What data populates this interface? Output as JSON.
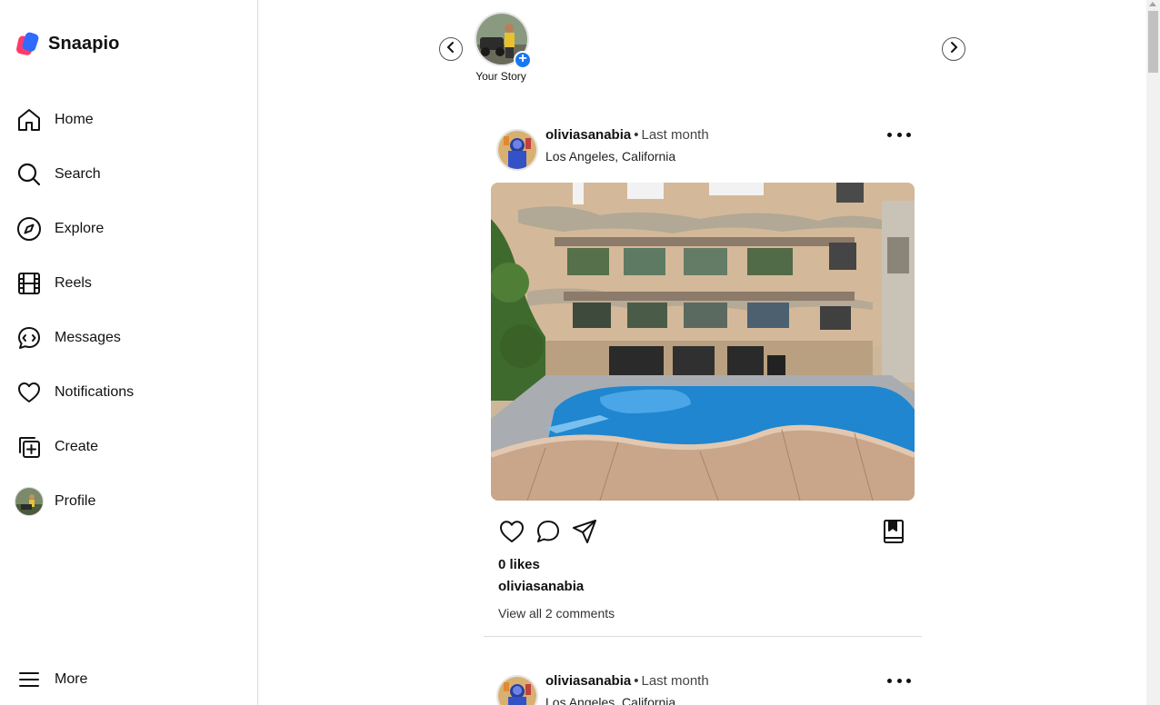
{
  "brand": {
    "name": "Snaapio",
    "colors": {
      "logo_primary": "#2f6bff",
      "logo_secondary": "#ff3b6b"
    }
  },
  "sidebar": {
    "items": [
      {
        "label": "Home",
        "icon": "home-icon"
      },
      {
        "label": "Search",
        "icon": "search-icon"
      },
      {
        "label": "Explore",
        "icon": "compass-icon"
      },
      {
        "label": "Reels",
        "icon": "film-icon"
      },
      {
        "label": "Messages",
        "icon": "chat-icon"
      },
      {
        "label": "Notifications",
        "icon": "heart-icon"
      },
      {
        "label": "Create",
        "icon": "add-square-icon"
      },
      {
        "label": "Profile",
        "icon": "avatar"
      }
    ],
    "more_label": "More"
  },
  "stories": {
    "items": [
      {
        "label": "Your Story"
      }
    ]
  },
  "feed": {
    "posts": [
      {
        "username": "oliviasanabia",
        "time": "Last month",
        "location": "Los Angeles, California",
        "likes": "0 likes",
        "caption_user": "oliviasanabia",
        "comments_link": "View all 2 comments"
      },
      {
        "username": "oliviasanabia",
        "time": "Last month",
        "location": "Los Angeles, California"
      }
    ]
  },
  "colors": {
    "accent_blue": "#1877f2",
    "border": "#dbdbdb"
  }
}
